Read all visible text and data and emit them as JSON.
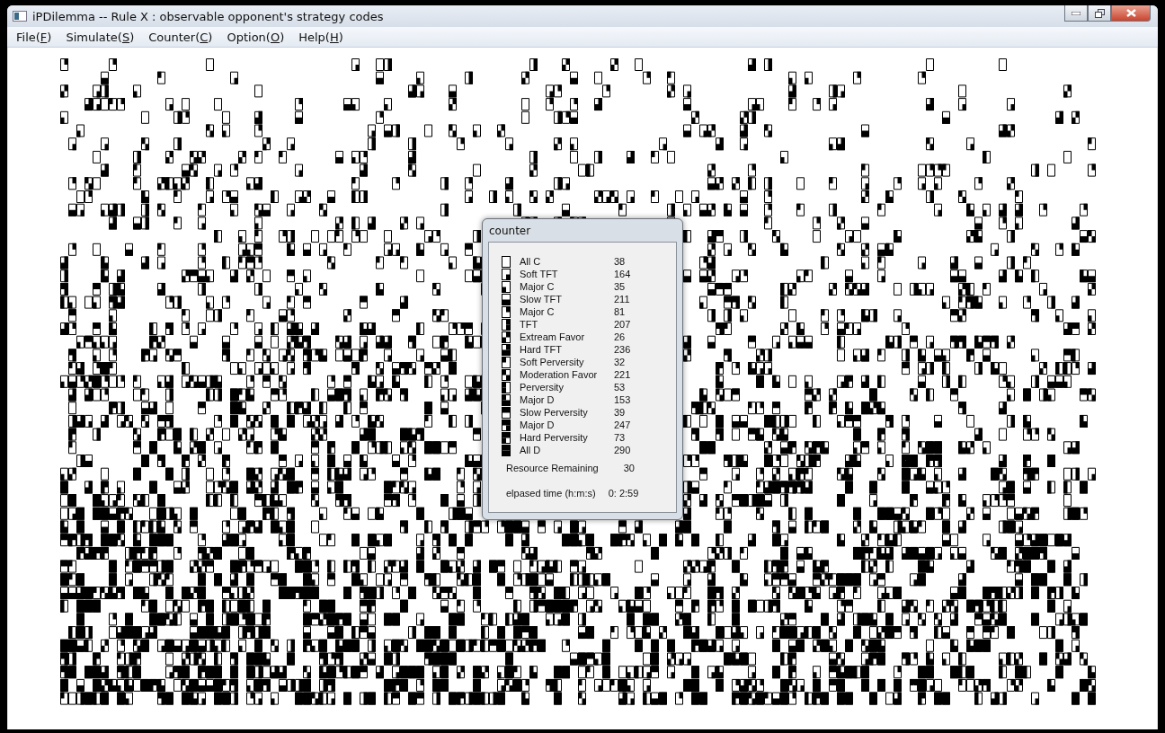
{
  "window": {
    "title": "iPDilemma -- Rule X : observable opponent's strategy codes"
  },
  "menu": [
    "File(F)",
    "Simulate(S)",
    "Counter(C)",
    "Option(O)",
    "Help(H)"
  ],
  "counter": {
    "title": "counter",
    "strategies": [
      {
        "name": "All C",
        "count": "38"
      },
      {
        "name": "Soft TFT",
        "count": "164"
      },
      {
        "name": "Major C",
        "count": "35"
      },
      {
        "name": "Slow TFT",
        "count": "211"
      },
      {
        "name": "Major C",
        "count": "81"
      },
      {
        "name": "TFT",
        "count": "207"
      },
      {
        "name": "Extream Favor",
        "count": "26"
      },
      {
        "name": "Hard TFT",
        "count": "236"
      },
      {
        "name": "Soft Perversity",
        "count": "32"
      },
      {
        "name": "Moderation Favor",
        "count": "221"
      },
      {
        "name": "Perversity",
        "count": "53"
      },
      {
        "name": "Major D",
        "count": "153"
      },
      {
        "name": "Slow Perversity",
        "count": "39"
      },
      {
        "name": "Major D",
        "count": "247"
      },
      {
        "name": "Hard Perversity",
        "count": "73"
      },
      {
        "name": "All D",
        "count": "290"
      }
    ],
    "resource": {
      "label": "Resource Remaining",
      "value": "30"
    },
    "elapsed": {
      "label": "elpased time (h:m:s)",
      "value": "0: 2:59"
    }
  }
}
